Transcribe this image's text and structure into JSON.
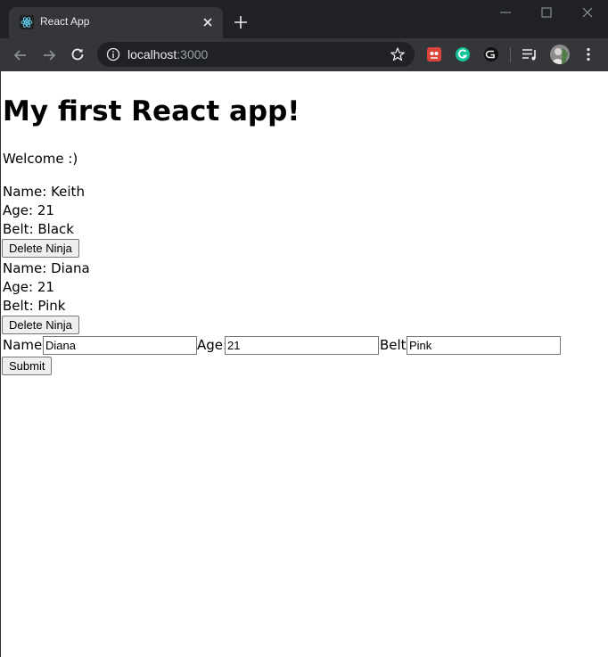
{
  "browser": {
    "tab_title": "React App",
    "url_host": "localhost",
    "url_port": ":3000",
    "colors": {
      "frame": "#202124",
      "toolbar": "#35363a"
    }
  },
  "page": {
    "title": "My first React app!",
    "welcome": "Welcome :)",
    "ninjas": [
      {
        "name_line": "Name: Keith",
        "age_line": "Age: 21",
        "belt_line": "Belt: Black",
        "delete_label": "Delete Ninja"
      },
      {
        "name_line": "Name: Diana",
        "age_line": "Age: 21",
        "belt_line": "Belt: Pink",
        "delete_label": "Delete Ninja"
      }
    ],
    "form": {
      "name_label": "Name:",
      "name_value": "Diana",
      "age_label": "Age:",
      "age_value": "21",
      "belt_label": "Belt:",
      "belt_value": "Pink",
      "submit_label": "Submit"
    }
  }
}
